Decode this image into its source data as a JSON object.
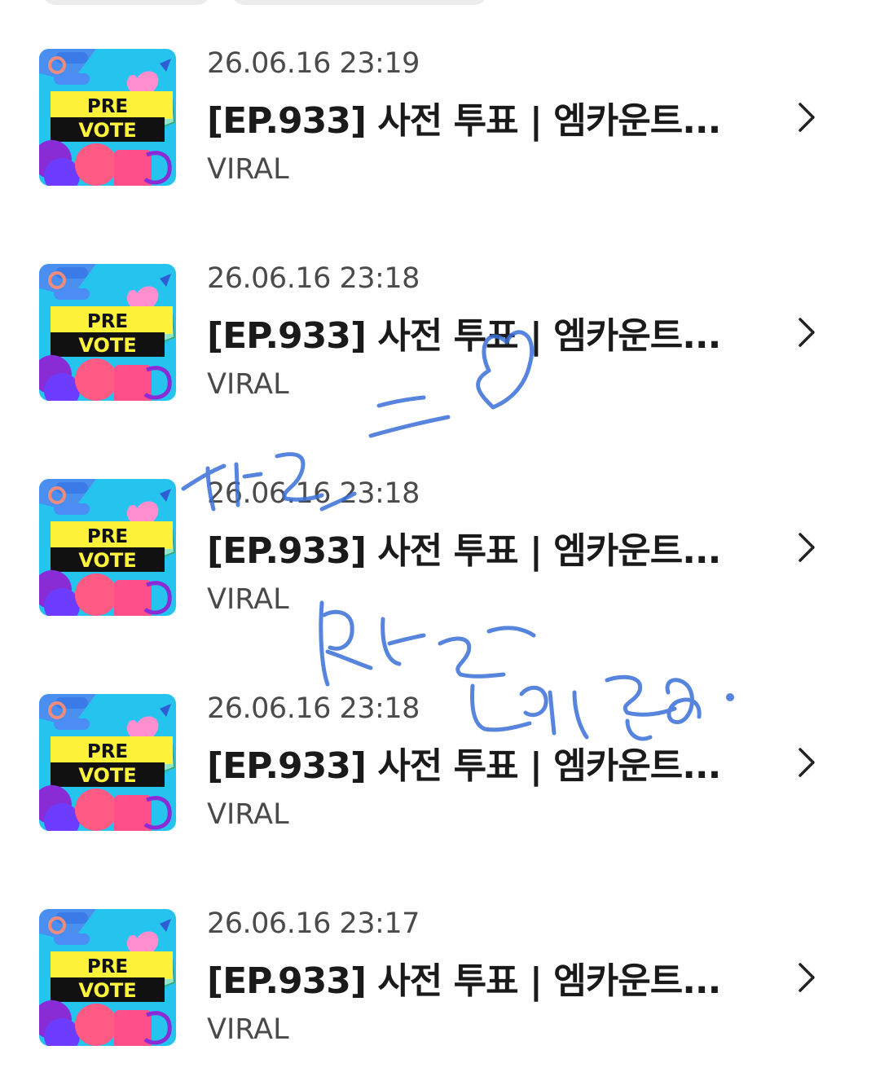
{
  "feed": {
    "items": [
      {
        "date": "26.06.16 23:19",
        "title": "[EP.933] 사전 투표 | 엠카운트...",
        "tag": "VIRAL",
        "thumb_text_top": "PRE",
        "thumb_text_bottom": "VOTE"
      },
      {
        "date": "26.06.16 23:18",
        "title": "[EP.933] 사전 투표 | 엠카운트...",
        "tag": "VIRAL",
        "thumb_text_top": "PRE",
        "thumb_text_bottom": "VOTE"
      },
      {
        "date": "26.06.16 23:18",
        "title": "[EP.933] 사전 투표 | 엠카운트...",
        "tag": "VIRAL",
        "thumb_text_top": "PRE",
        "thumb_text_bottom": "VOTE"
      },
      {
        "date": "26.06.16 23:18",
        "title": "[EP.933] 사전 투표 | 엠카운트...",
        "tag": "VIRAL",
        "thumb_text_top": "PRE",
        "thumb_text_bottom": "VOTE"
      },
      {
        "date": "26.06.16 23:17",
        "title": "[EP.933] 사전 투표 | 엠카운트...",
        "tag": "VIRAL",
        "thumb_text_top": "PRE",
        "thumb_text_bottom": "VOTE"
      }
    ]
  },
  "icons": {
    "chevron": "chevron-right-icon"
  },
  "colors": {
    "thumb_bg": "#25c4ee",
    "thumb_banner": "#fff23a",
    "scribble": "#3a6fd8"
  }
}
